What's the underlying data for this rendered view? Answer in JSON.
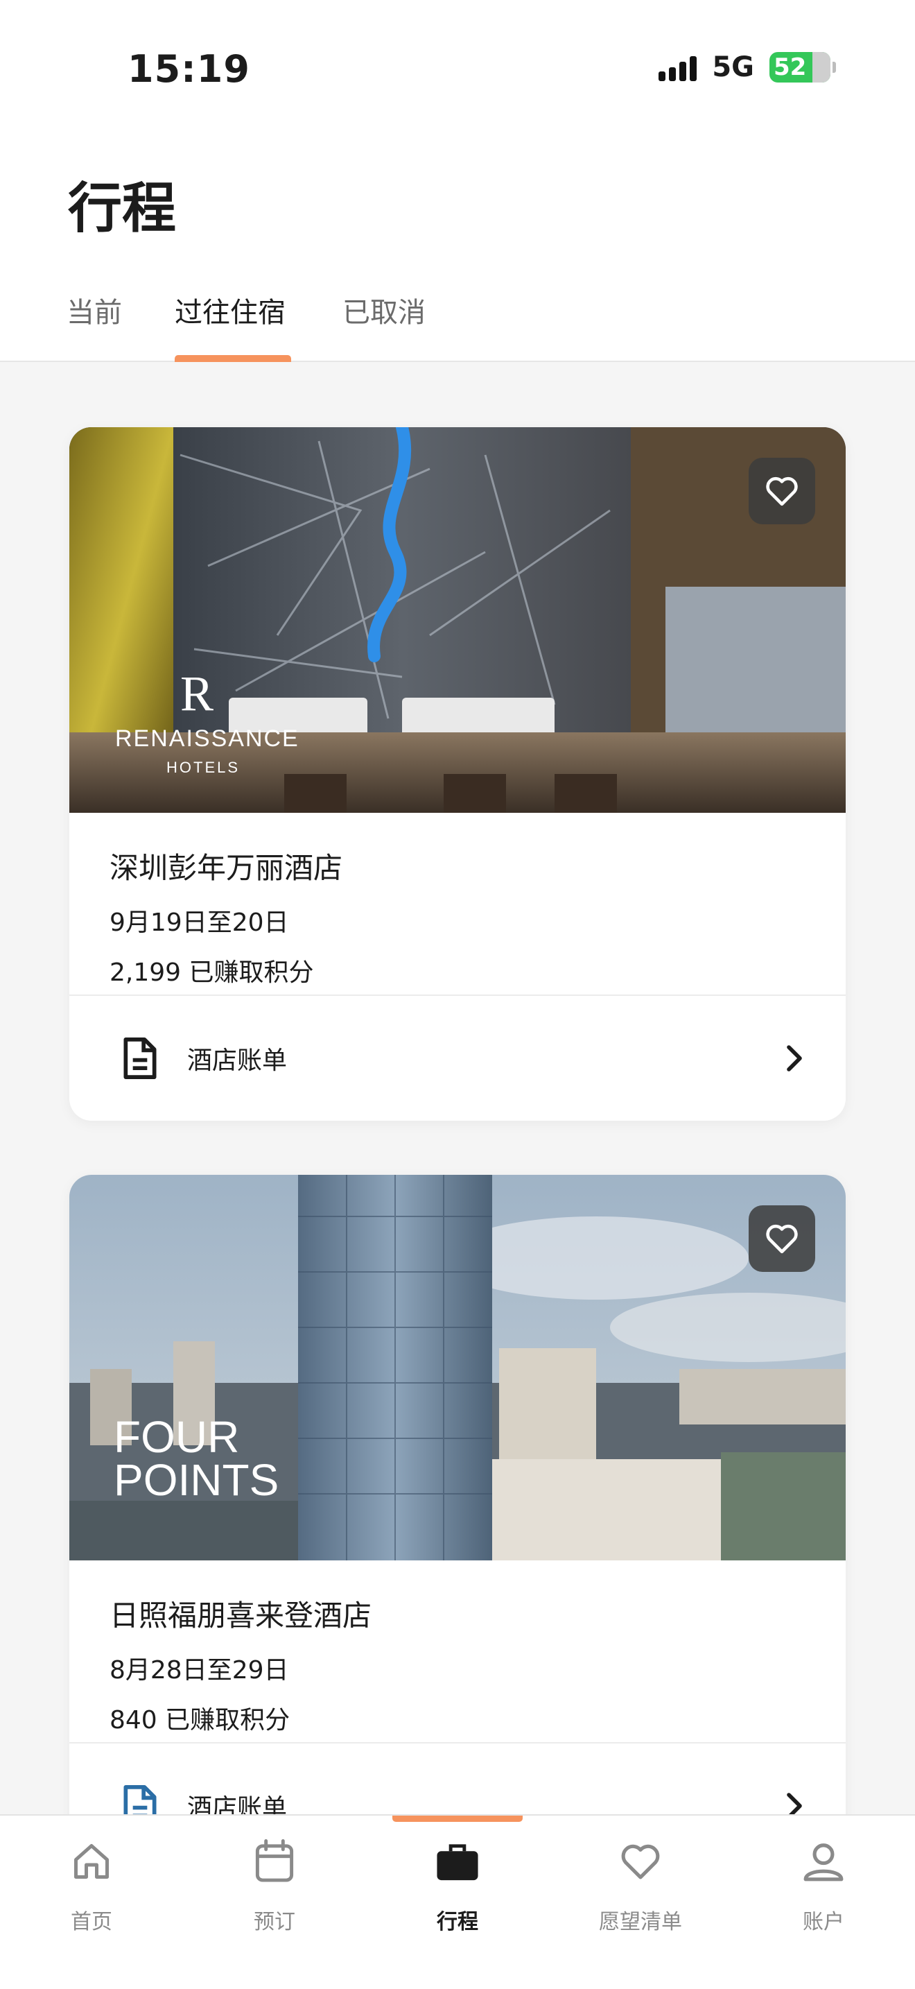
{
  "status_bar": {
    "time": "15:19",
    "network": "5G",
    "battery": "52"
  },
  "header": {
    "title": "行程"
  },
  "tabs": [
    {
      "label": "当前",
      "active": false
    },
    {
      "label": "过往住宿",
      "active": true
    },
    {
      "label": "已取消",
      "active": false
    }
  ],
  "stays": [
    {
      "brand_logo_text": [
        "R",
        "RENAISSANCE",
        "HOTELS"
      ],
      "name": "深圳彭年万丽酒店",
      "dates": "9月19日至20日",
      "points": "2,199 已赚取积分",
      "bill_label": "酒店账单"
    },
    {
      "brand_logo_text": [
        "FOUR",
        "POINTS"
      ],
      "name": "日照福朋喜来登酒店",
      "dates": "8月28日至29日",
      "points": "840 已赚取积分",
      "bill_label": "酒店账单"
    }
  ],
  "bottom_nav": [
    {
      "label": "首页",
      "icon": "home-icon",
      "active": false
    },
    {
      "label": "预订",
      "icon": "calendar-icon",
      "active": false
    },
    {
      "label": "行程",
      "icon": "briefcase-icon",
      "active": true
    },
    {
      "label": "愿望清单",
      "icon": "heart-icon",
      "active": false
    },
    {
      "label": "账户",
      "icon": "user-icon",
      "active": false
    }
  ],
  "colors": {
    "accent": "#f6935d",
    "battery": "#34c759",
    "text": "#1c1c1c",
    "muted": "#8a8a8a"
  }
}
